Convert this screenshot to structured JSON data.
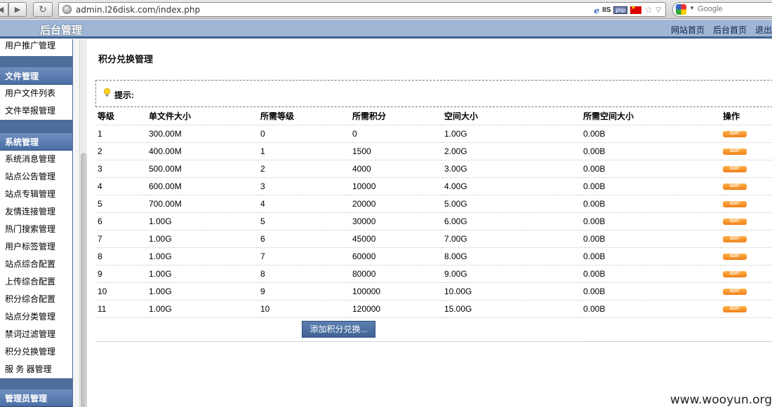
{
  "browser": {
    "url": "admin.l26disk.com/index.php",
    "iis_label": "IIS",
    "php_label": "php",
    "search_placeholder": "Google"
  },
  "header": {
    "site_title": "后台管理",
    "links": [
      "网站首页",
      "后台首页",
      "退出"
    ]
  },
  "sidebar": {
    "top_item": "用户推广管理",
    "groups": [
      {
        "title": "文件管理",
        "items": [
          "用户文件列表",
          "文件举报管理"
        ]
      },
      {
        "title": "系统管理",
        "items": [
          "系统消息管理",
          "站点公告管理",
          "站点专辑管理",
          "友情连接管理",
          "热门搜索管理",
          "用户标签管理",
          "站点综合配置",
          "上传综合配置",
          "积分综合配置",
          "站点分类管理",
          "禁词过滤管理",
          "积分兑换管理",
          "服 务 器管理"
        ]
      },
      {
        "title": "管理员管理"
      }
    ]
  },
  "main": {
    "page_title": "积分兑换管理",
    "tip_label": "提示:",
    "columns": [
      "等级",
      "单文件大小",
      "所需等级",
      "所需积分",
      "空间大小",
      "所需空间大小",
      "操作"
    ],
    "rows": [
      [
        "1",
        "300.00M",
        "0",
        "0",
        "1.00G",
        "0.00B"
      ],
      [
        "2",
        "400.00M",
        "1",
        "1500",
        "2.00G",
        "0.00B"
      ],
      [
        "3",
        "500.00M",
        "2",
        "4000",
        "3.00G",
        "0.00B"
      ],
      [
        "4",
        "600.00M",
        "3",
        "10000",
        "4.00G",
        "0.00B"
      ],
      [
        "5",
        "700.00M",
        "4",
        "20000",
        "5.00G",
        "0.00B"
      ],
      [
        "6",
        "1.00G",
        "5",
        "30000",
        "6.00G",
        "0.00B"
      ],
      [
        "7",
        "1.00G",
        "6",
        "45000",
        "7.00G",
        "0.00B"
      ],
      [
        "8",
        "1.00G",
        "7",
        "60000",
        "8.00G",
        "0.00B"
      ],
      [
        "9",
        "1.00G",
        "8",
        "80000",
        "9.00G",
        "0.00B"
      ],
      [
        "10",
        "1.00G",
        "9",
        "100000",
        "10.00G",
        "0.00B"
      ],
      [
        "11",
        "1.00G",
        "10",
        "120000",
        "15.00G",
        "0.00B"
      ]
    ],
    "edit_label": "EDIT",
    "add_button": "添加积分兑换..."
  },
  "watermark": "www.wooyun.org"
}
